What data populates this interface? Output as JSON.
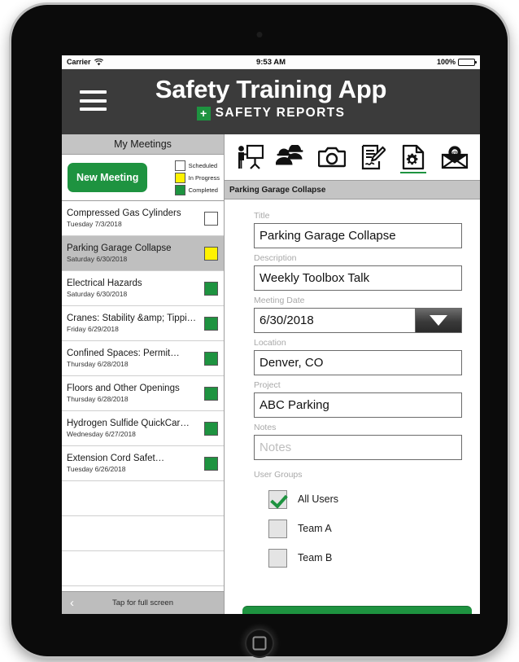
{
  "status_bar": {
    "carrier": "Carrier",
    "wifi_icon": "wifi-icon",
    "time": "9:53 AM",
    "battery_percent": "100%"
  },
  "header": {
    "menu_icon": "hamburger-menu-icon",
    "title": "Safety Training App",
    "brand_plus": "+",
    "brand_text": "SAFETY REPORTS"
  },
  "sidebar": {
    "title": "My Meetings",
    "new_meeting_label": "New Meeting",
    "legend": [
      {
        "label": "Scheduled",
        "color": "#ffffff"
      },
      {
        "label": "In Progress",
        "color": "#fff200"
      },
      {
        "label": "Completed",
        "color": "#1e9340"
      }
    ],
    "meetings": [
      {
        "title": "Compressed Gas Cylinders",
        "date": "Tuesday 7/3/2018",
        "status": "#ffffff",
        "selected": false
      },
      {
        "title": "Parking Garage Collapse",
        "date": "Saturday 6/30/2018",
        "status": "#fff200",
        "selected": true
      },
      {
        "title": "Electrical Hazards",
        "date": "Saturday 6/30/2018",
        "status": "#1e9340",
        "selected": false
      },
      {
        "title": "Cranes: Stability &amp; Tippi…",
        "date": "Friday 6/29/2018",
        "status": "#1e9340",
        "selected": false
      },
      {
        "title": "Confined Spaces: Permit…",
        "date": "Thursday 6/28/2018",
        "status": "#1e9340",
        "selected": false
      },
      {
        "title": "Floors and Other Openings",
        "date": "Thursday 6/28/2018",
        "status": "#1e9340",
        "selected": false
      },
      {
        "title": "Hydrogen Sulfide QuickCar…",
        "date": "Wednesday 6/27/2018",
        "status": "#1e9340",
        "selected": false
      },
      {
        "title": "Extension Cord Safet…",
        "date": "Tuesday 6/26/2018",
        "status": "#1e9340",
        "selected": false
      }
    ],
    "empty_row_count": 4,
    "footer": {
      "chevron": "‹",
      "label": "Tap for full screen"
    }
  },
  "toolbar": {
    "icons": [
      {
        "name": "presentation-trainer-icon",
        "active": false
      },
      {
        "name": "attendees-hardhat-icon",
        "active": false
      },
      {
        "name": "camera-icon",
        "active": false
      },
      {
        "name": "signature-notes-icon",
        "active": false
      },
      {
        "name": "document-settings-icon",
        "active": true
      },
      {
        "name": "email-envelope-icon",
        "active": false
      }
    ]
  },
  "breadcrumb": "Parking Garage Collapse",
  "form": {
    "fields": [
      {
        "label": "Title",
        "value": "Parking Garage Collapse",
        "placeholder": "",
        "type": "text"
      },
      {
        "label": "Description",
        "value": "Weekly Toolbox Talk",
        "placeholder": "",
        "type": "text"
      },
      {
        "label": "Meeting Date",
        "value": "6/30/2018",
        "placeholder": "",
        "type": "date"
      },
      {
        "label": "Location",
        "value": "Denver, CO",
        "placeholder": "",
        "type": "text"
      },
      {
        "label": "Project",
        "value": "ABC Parking",
        "placeholder": "",
        "type": "text"
      },
      {
        "label": "Notes",
        "value": "",
        "placeholder": "Notes",
        "type": "text"
      }
    ],
    "user_groups_label": "User Groups",
    "user_groups": [
      {
        "label": "All Users",
        "checked": true
      },
      {
        "label": "Team A",
        "checked": false
      },
      {
        "label": "Team B",
        "checked": false
      }
    ]
  },
  "colors": {
    "brand_green": "#1e9340",
    "header_dark": "#3b3b3b",
    "in_progress_yellow": "#fff200",
    "panel_gray": "#c4c4c4"
  }
}
